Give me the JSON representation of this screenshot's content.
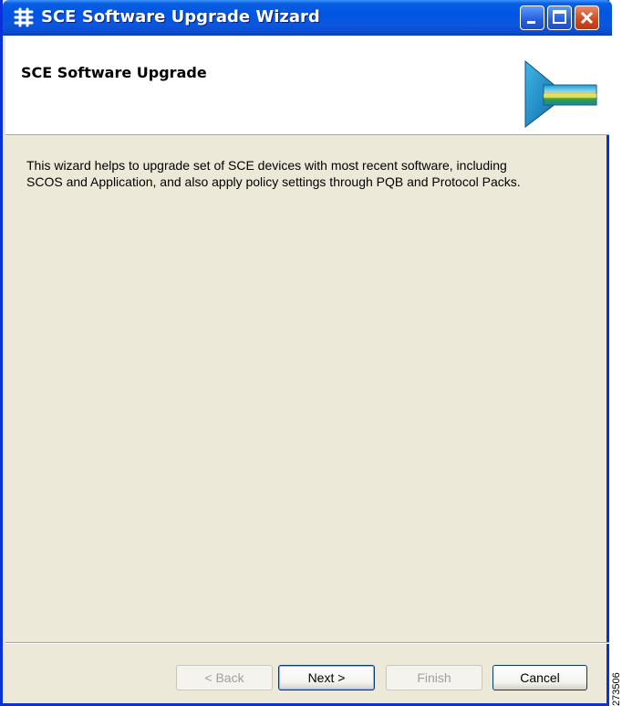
{
  "window": {
    "title": "SCE Software Upgrade Wizard",
    "controls": {
      "minimize_icon": "minimize-icon",
      "maximize_icon": "maximize-icon",
      "close_icon": "close-icon"
    }
  },
  "header": {
    "title": "SCE Software Upgrade",
    "graphic_icon": "wizard-banner-icon"
  },
  "content": {
    "description_line1": "This wizard helps to upgrade set of SCE devices with most recent software, including",
    "description_line2": "SCOS and Application, and also apply policy settings through PQB and Protocol Packs."
  },
  "buttons": {
    "back": "< Back",
    "next": "Next >",
    "finish": "Finish",
    "cancel": "Cancel"
  },
  "figure_id": "273506",
  "colors": {
    "titlebar": "#0055e5",
    "window_bg": "#ece9d8",
    "header_bg": "#ffffff",
    "close_button": "#d24b21"
  }
}
